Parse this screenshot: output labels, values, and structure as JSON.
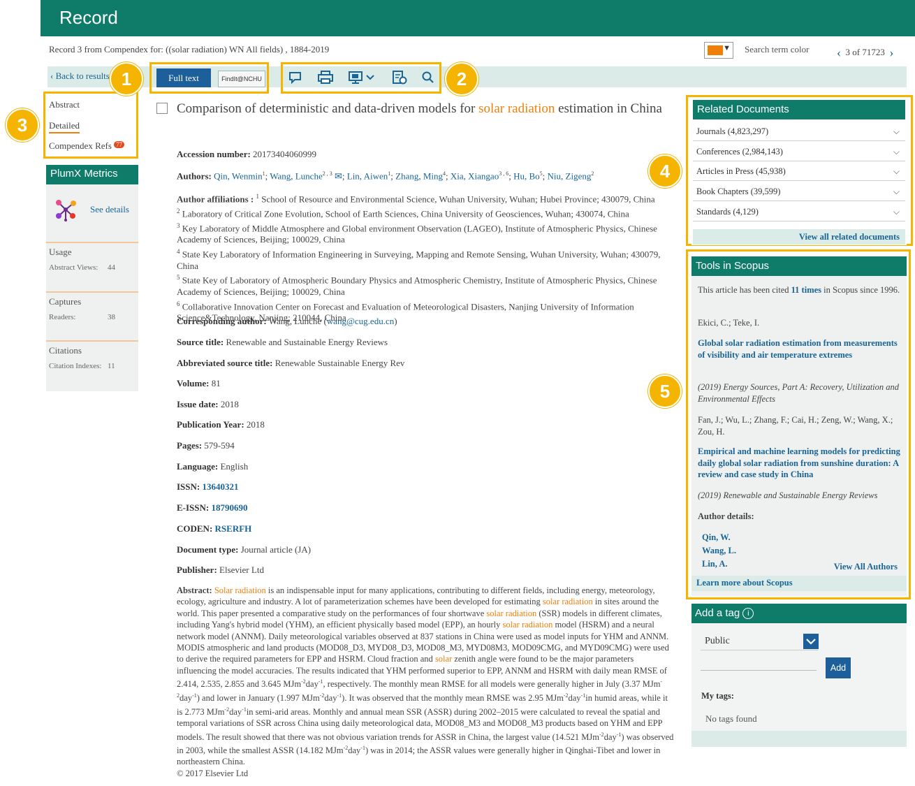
{
  "header": {
    "title": "Record"
  },
  "record_info": "Record 3 from Compendex for: ((solar radiation) WN All fields) , 1884-2019",
  "search_term_color": {
    "label": "Search term color",
    "color": "#f07f0a"
  },
  "pager": {
    "text": "3 of 71723"
  },
  "toolbar": {
    "back_label": "Back to results",
    "full_text_label": "Full text",
    "findit_label": "FindIt@NCHU",
    "icons": [
      "comment-icon",
      "print-icon",
      "display-icon",
      "export-icon",
      "search-icon"
    ]
  },
  "callouts": [
    "1",
    "2",
    "3",
    "4",
    "5"
  ],
  "leftnav": {
    "abstract": "Abstract",
    "detailed": "Detailed",
    "refs": "Compendex Refs",
    "refs_count": "77"
  },
  "plumx": {
    "title": "PlumX Metrics",
    "see_details": "See details",
    "usage": {
      "label": "Usage",
      "metric": "Abstract Views:",
      "value": "44"
    },
    "captures": {
      "label": "Captures",
      "metric": "Readers:",
      "value": "38"
    },
    "citations": {
      "label": "Citations",
      "metric": "Citation Indexes:",
      "value": "11"
    }
  },
  "article": {
    "title_before": "Comparison of deterministic and data-driven models for ",
    "title_highlight": "solar radiation",
    "title_after": " estimation in China",
    "accession_label": "Accession number:",
    "accession": "20173404060999",
    "authors_label": "Authors:",
    "authors": [
      {
        "name": "Qin, Wenmin",
        "sup": "1"
      },
      {
        "name": "Wang, Lunche",
        "sup": "2 , 3"
      },
      {
        "name": "Lin, Aiwen",
        "sup": "1"
      },
      {
        "name": "Zhang, Ming",
        "sup": "4"
      },
      {
        "name": "Xia, Xiangao",
        "sup": "3 , 6"
      },
      {
        "name": "Hu, Bo",
        "sup": "5"
      },
      {
        "name": "Niu, Zigeng",
        "sup": "2"
      }
    ],
    "affiliations_label": "Author affiliations :",
    "affiliations": [
      {
        "n": "1",
        "text": "School of Resource and Environmental Science, Wuhan University, Wuhan; Hubei Province; 430079, China"
      },
      {
        "n": "2",
        "text": "Laboratory of Critical Zone Evolution, School of Earth Sciences, China University of Geosciences, Wuhan; 430074, China"
      },
      {
        "n": "3",
        "text": "Key Laboratory of Middle Atmosphere and Global environment Observation (LAGEO), Institute of Atmospheric Physics, Chinese Academy of Sciences, Beijing; 100029, China"
      },
      {
        "n": "4",
        "text": "State Key Laboratory of Information Engineering in Surveying, Mapping and Remote Sensing, Wuhan University, Wuhan; 430079, China"
      },
      {
        "n": "5",
        "text": "State Key of Laboratory of Atmospheric Boundary Physics and Atmospheric Chemistry, Institute of Atmospheric Physics, Chinese Academy of Sciences, Beijing; 100029, China"
      },
      {
        "n": "6",
        "text": "Collaborative Innovation Center on Forecast and Evaluation of Meteorological Disasters, Nanjing University of Information Science&Technology, Nanjing; 210044, China"
      }
    ],
    "corresponding_label": "Corresponding author:",
    "corresponding_name": "Wang, Lunche (",
    "corresponding_email": "wang@cug.edu.cn",
    "corresponding_close": ")",
    "source_label": "Source title:",
    "source": "Renewable and Sustainable Energy Reviews",
    "abbr_label": "Abbreviated source title:",
    "abbr": "Renewable Sustainable Energy Rev",
    "volume_label": "Volume:",
    "volume": "81",
    "issue_label": "Issue date:",
    "issue": "2018",
    "year_label": "Publication Year:",
    "year": "2018",
    "pages_label": "Pages:",
    "pages": "579-594",
    "language_label": "Language:",
    "language": "English",
    "issn_label": "ISSN:",
    "issn": "13640321",
    "eissn_label": "E-ISSN:",
    "eissn": "18790690",
    "coden_label": "CODEN:",
    "coden": "RSERFH",
    "doctype_label": "Document type:",
    "doctype": "Journal article (JA)",
    "publisher_label": "Publisher:",
    "publisher": "Elsevier Ltd",
    "abstract_label": "Abstract:",
    "abstract_parts": [
      {
        "t": "Solar radiation",
        "h": true
      },
      {
        "t": " is an indispensable input for many applications, contributing to different fields, including energy, meteorology, ecology, agriculture and industry. A lot of parameterization schemes have been developed for estimating "
      },
      {
        "t": "solar radiation",
        "h": true
      },
      {
        "t": " in sites around the world. This paper presented a comparative study on the performances of four shortwave "
      },
      {
        "t": "solar radiation",
        "h": true
      },
      {
        "t": " (SSR) models in different climates, including Yang's hybrid model (YHM), an efficient physically based model (EPP), an hourly "
      },
      {
        "t": "solar radiation",
        "h": true
      },
      {
        "t": " model (HSRM) and a neural network model (ANNM). Daily meteorological variables observed at 837 stations in China were used as model inputs for YHM and ANNM. MODIS atmospheric and land products (MOD08_D3, MYD08_D3, MOD08_M3, MYD08M3, MOD09CMG, and MYD09CMG) were used to derive the required parameters for EPP and HSRM. Cloud fraction and "
      },
      {
        "t": "solar",
        "h": true
      },
      {
        "t": " zenith angle were found to be the major parameters influencing the model accuracies. The results indicated that YHM performed superior to EPP, ANNM and HSRM with daily mean RMSE of 2.414, 2.535, 2.855 and 3.645 MJm"
      },
      {
        "t": "-2",
        "sup": true
      },
      {
        "t": "day"
      },
      {
        "t": "-1",
        "sup": true
      },
      {
        "t": ", respectively. The monthly mean RMSE for all models were generally higher in July (3.37 MJm"
      },
      {
        "t": "-2",
        "sup": true
      },
      {
        "t": "day"
      },
      {
        "t": "-1",
        "sup": true
      },
      {
        "t": ") and lower in January (1.997 MJm"
      },
      {
        "t": "-2",
        "sup": true
      },
      {
        "t": "day"
      },
      {
        "t": "-1",
        "sup": true
      },
      {
        "t": "). It was observed that the monthly mean RMSE was 2.95 MJm"
      },
      {
        "t": "-2",
        "sup": true
      },
      {
        "t": "day"
      },
      {
        "t": "-1",
        "sup": true
      },
      {
        "t": "in humid areas, while it is 2.773 MJm"
      },
      {
        "t": "-2",
        "sup": true
      },
      {
        "t": "day"
      },
      {
        "t": "-1",
        "sup": true
      },
      {
        "t": "in semi-arid areas. Monthly and annual mean SSR (ASSR) during 2002–2015 were calculated to reveal the spatial and temporal variations of SSR across China using daily meteorological data, MOD08_M3 and MOD08_M3 products based on YHM and EPP models. The result showed that there was not obvious variation trends for ASSR in China, the largest value (14.521 MJm"
      },
      {
        "t": "-2",
        "sup": true
      },
      {
        "t": "day"
      },
      {
        "t": "-1",
        "sup": true
      },
      {
        "t": ") was observed in 2003, while the smallest ASSR (14.182 MJm"
      },
      {
        "t": "-2",
        "sup": true
      },
      {
        "t": "day"
      },
      {
        "t": "-1",
        "sup": true
      },
      {
        "t": ") was in 2014; the ASSR values were generally higher in Qinghai-Tibet and lower in northeastern China."
      }
    ],
    "copyright": "© 2017 Elsevier Ltd"
  },
  "related": {
    "title": "Related Documents",
    "rows": [
      "Journals (4,823,297)",
      "Conferences (2,984,143)",
      "Articles in Press (45,938)",
      "Book Chapters (39,599)",
      "Standards (4,129)"
    ],
    "view_all": "View all related documents"
  },
  "tools": {
    "title": "Tools in Scopus",
    "cited_pre": "This article has been cited ",
    "cited_link": "11 times",
    "cited_post": " in Scopus since 1996.",
    "docs": [
      {
        "authors": "Ekici, C.; Teke, I.",
        "title": "Global solar radiation estimation from measurements of visibility and air temperature extremes",
        "source": "(2019) Energy Sources, Part A: Recovery, Utilization and Environmental Effects"
      },
      {
        "authors": "Fan, J.; Wu, L.; Zhang, F.; Cai, H.; Zeng, W.; Wang, X.; Zou, H.",
        "title": "Empirical and machine learning models for predicting daily global solar radiation from sunshine duration: A review and case study in China",
        "source": "(2019) Renewable and Sustainable Energy Reviews"
      }
    ],
    "author_details": "Author details:",
    "author_links": [
      "Qin, W.",
      "Wang, L.",
      "Lin, A."
    ],
    "view_all_authors": "View All Authors",
    "learn_more": "Learn more about Scopus"
  },
  "tag": {
    "title": "Add a tag",
    "select_value": "Public",
    "add_label": "Add",
    "my_tags": "My tags:",
    "no_tags": "No tags found"
  }
}
